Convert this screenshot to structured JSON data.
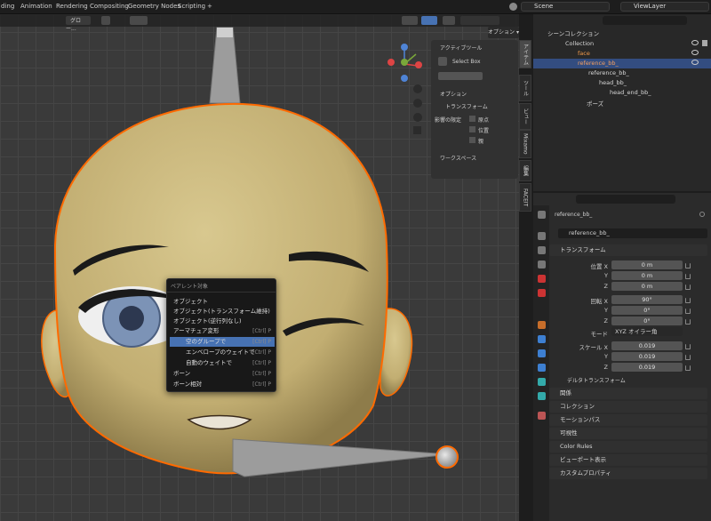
{
  "workspace_tabs": [
    "ding",
    "Animation",
    "Rendering",
    "Compositing",
    "Geometry Nodes",
    "Scripting",
    "+"
  ],
  "scene": {
    "label": "Scene",
    "viewlayer": "ViewLayer"
  },
  "viewport": {
    "transform_orientation": "グロー...",
    "options_label": "オプション ▾"
  },
  "npanel": {
    "active_tool": "アクティブツール",
    "select_box": "Select Box",
    "options": "オプション",
    "transform": "トランスフォーム",
    "affect_only": "影響の限定",
    "origin": "原点",
    "location": "位置",
    "parent": "親",
    "workspace": "ワークスペース"
  },
  "side_tabs": [
    "アイテム",
    "ツール",
    "ビュー",
    "Mixamo",
    "編集",
    "FACEIT"
  ],
  "outliner": {
    "scene_collection": "シーンコレクション",
    "rows": [
      "Collection",
      "face",
      "reference_bb_",
      "reference_bb_",
      "head_bb_",
      "head_end_bb_",
      "ポーズ"
    ]
  },
  "props": {
    "object_name": "reference_bb_",
    "data_name": "reference_bb_",
    "transform": "トランスフォーム",
    "location_x": "位置 X",
    "y": "Y",
    "z": "Z",
    "rotation_x": "回転 X",
    "mode": "モード",
    "scale_x": "スケール X",
    "loc": [
      "0 m",
      "0 m",
      "0 m"
    ],
    "rot": [
      "90°",
      "0°",
      "0°"
    ],
    "mode_val": "XYZ オイラー角",
    "scale": [
      "0.019",
      "0.019",
      "0.019"
    ],
    "delta": "デルタトランスフォーム",
    "sections": [
      "関係",
      "コレクション",
      "モーションパス",
      "可視性",
      "Color Rules",
      "ビューポート表示",
      "カスタムプロパティ"
    ]
  },
  "menu": {
    "title": "ペアレント対象",
    "items": [
      {
        "label": "オブジェクト",
        "sc": ""
      },
      {
        "label": "オブジェクト(トランスフォーム維持)",
        "sc": ""
      },
      {
        "label": "オブジェクト(逆行列なし)",
        "sc": ""
      },
      {
        "label": "アーマチュア変形",
        "sc": "[Ctrl] P"
      },
      {
        "label": "空のグループで",
        "sc": "[Ctrl] P"
      },
      {
        "label": "エンベロープのウェイトで",
        "sc": "[Ctrl] P"
      },
      {
        "label": "自動のウェイトで",
        "sc": "[Ctrl] P"
      },
      {
        "label": "ボーン",
        "sc": "[Ctrl] P"
      },
      {
        "label": "ボーン相対",
        "sc": "[Ctrl] P"
      }
    ]
  },
  "colors": {
    "accent": "#4772b3",
    "selection": "#334d80",
    "skin": "#c9b67c",
    "outline": "#ff6a00"
  }
}
